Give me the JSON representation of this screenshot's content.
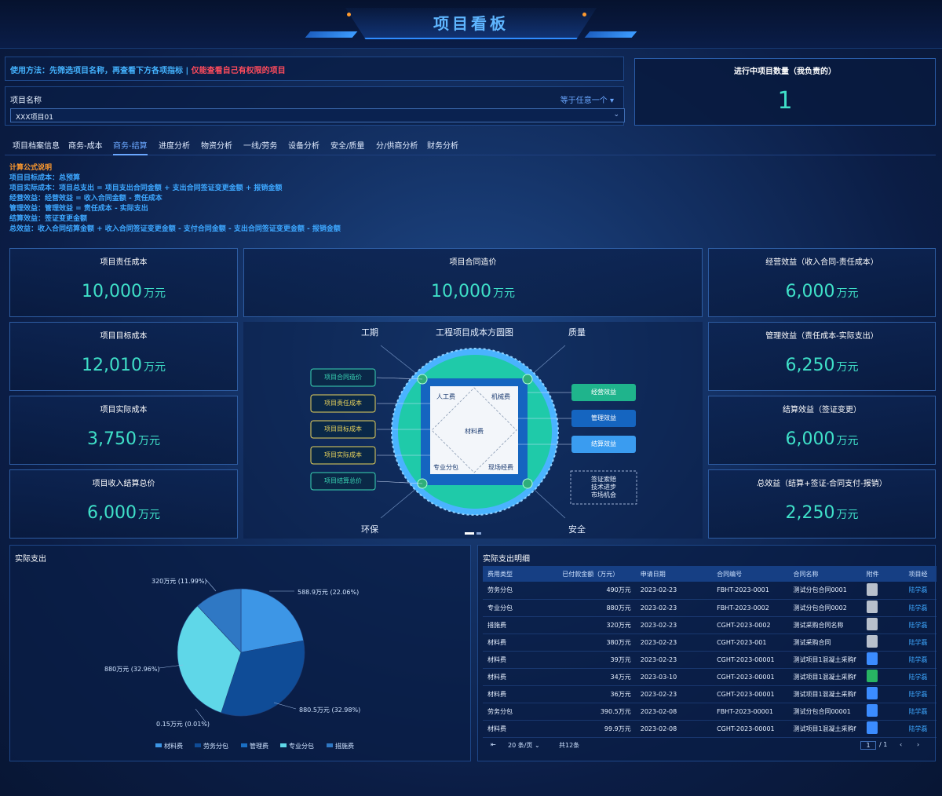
{
  "header": {
    "title": "项目看板"
  },
  "usage": {
    "part1": "使用方法：先筛选项目名称，再查看下方各项指标",
    "sep": "|",
    "part2": "仅能查看自己有权限的项目"
  },
  "filter": {
    "label": "项目名称",
    "operator": "等于任意一个",
    "value": "XXX项目01"
  },
  "count_card": {
    "label": "进行中项目数量（我负责的）",
    "value": "1"
  },
  "tabs": [
    "项目档案信息",
    "商务-成本",
    "商务-结算",
    "进度分析",
    "物资分析",
    "一线/劳务",
    "设备分析",
    "安全/质量",
    "分/供商分析",
    "财务分析"
  ],
  "active_tab": "商务-结算",
  "formula": {
    "head": "计算公式说明",
    "lines": [
      "项目目标成本：总预算",
      "项目实际成本：项目总支出 = 项目支出合同金额 + 支出合同签证变更金额 + 报销金额",
      "经营效益：经营效益 = 收入合同金额 - 责任成本",
      "管理效益：管理效益 = 责任成本 - 实际支出",
      "结算效益：签证变更金额",
      "总效益：收入合同结算金额 + 收入合同签证变更金额 - 支付合同金额 - 支出合同签证变更金额 - 报销金额"
    ]
  },
  "metrics": {
    "responsibility_cost": {
      "label": "项目责任成本",
      "value": "10,000",
      "unit": "万元"
    },
    "target_cost": {
      "label": "项目目标成本",
      "value": "12,010",
      "unit": "万元"
    },
    "actual_cost": {
      "label": "项目实际成本",
      "value": "3,750",
      "unit": "万元"
    },
    "income_settlement": {
      "label": "项目收入结算总价",
      "value": "6,000",
      "unit": "万元"
    },
    "contract_price": {
      "label": "项目合同造价",
      "value": "10,000",
      "unit": "万元"
    },
    "operating_benefit": {
      "label": "经营效益（收入合同-责任成本）",
      "value": "6,000",
      "unit": "万元"
    },
    "management_benefit": {
      "label": "管理效益（责任成本-实际支出）",
      "value": "6,250",
      "unit": "万元"
    },
    "settlement_benefit": {
      "label": "结算效益（签证变更）",
      "value": "6,000",
      "unit": "万元"
    },
    "total_benefit": {
      "label": "总效益（结算+签证-合同支付-报销）",
      "value": "2,250",
      "unit": "万元"
    }
  },
  "diagram": {
    "title": "工程项目成本方圆图",
    "corners": [
      "工期",
      "质量",
      "环保",
      "安全"
    ],
    "left_boxes": [
      "项目合同造价",
      "项目责任成本",
      "项目目标成本",
      "项目实际成本",
      "项目结算总价"
    ],
    "right_boxes": [
      "经营效益",
      "管理效益",
      "结算效益"
    ],
    "inner": [
      "人工费",
      "机械费",
      "材料费",
      "专业分包",
      "现场经费"
    ],
    "notes": [
      "签证索赔",
      "技术进步",
      "市场机会"
    ]
  },
  "expense_panel": {
    "title": "实际支出"
  },
  "chart_data": {
    "type": "pie",
    "categories": [
      "材料费",
      "劳务分包",
      "管理费",
      "专业分包",
      "措施费"
    ],
    "values": [
      588.9,
      880.5,
      0.15,
      880,
      320
    ],
    "labels": [
      "588.9万元 (22.06%)",
      "880.5万元 (32.98%)",
      "0.15万元 (0.01%)",
      "880万元 (32.96%)",
      "320万元 (11.99%)"
    ],
    "colors": [
      "#3d96e6",
      "#0f4c97",
      "#1a6fc4",
      "#5fd7e8",
      "#2f78c4"
    ]
  },
  "detail_panel": {
    "title": "实际支出明细",
    "columns": [
      "费用类型",
      "已付款金额（万元）",
      "申请日期",
      "合同编号",
      "合同名称",
      "附件",
      "项目经"
    ],
    "rows": [
      [
        "劳务分包",
        "490万元",
        "2023-02-23",
        "FBHT-2023-0001",
        "测试分包合同0001",
        "gray",
        "陆学磊"
      ],
      [
        "专业分包",
        "880万元",
        "2023-02-23",
        "FBHT-2023-0002",
        "测试分包合同0002",
        "gray",
        "陆学磊"
      ],
      [
        "措施费",
        "320万元",
        "2023-02-23",
        "CGHT-2023-0002",
        "测试采购合同名称",
        "gray",
        "陆学磊"
      ],
      [
        "材料费",
        "380万元",
        "2023-02-23",
        "CGHT-2023-001",
        "测试采购合同",
        "gray",
        "陆学磊"
      ],
      [
        "材料费",
        "39万元",
        "2023-02-23",
        "CGHT-2023-00001",
        "测试项目1混凝土采购f",
        "blue",
        "陆学磊"
      ],
      [
        "材料费",
        "34万元",
        "2023-03-10",
        "CGHT-2023-00001",
        "测试项目1混凝土采购f",
        "green",
        "陆学磊"
      ],
      [
        "材料费",
        "36万元",
        "2023-02-23",
        "CGHT-2023-00001",
        "测试项目1混凝土采购f",
        "blue",
        "陆学磊"
      ],
      [
        "劳务分包",
        "390.5万元",
        "2023-02-08",
        "FBHT-2023-00001",
        "测试分包合同00001",
        "blue",
        "陆学磊"
      ],
      [
        "材料费",
        "99.9万元",
        "2023-02-08",
        "CGHT-2023-00001",
        "测试项目1混凝土采购f",
        "blue",
        "陆学磊"
      ]
    ],
    "pager": {
      "per_page": "20 条/页",
      "total": "共12条",
      "page": "1",
      "pages": "/ 1"
    }
  }
}
